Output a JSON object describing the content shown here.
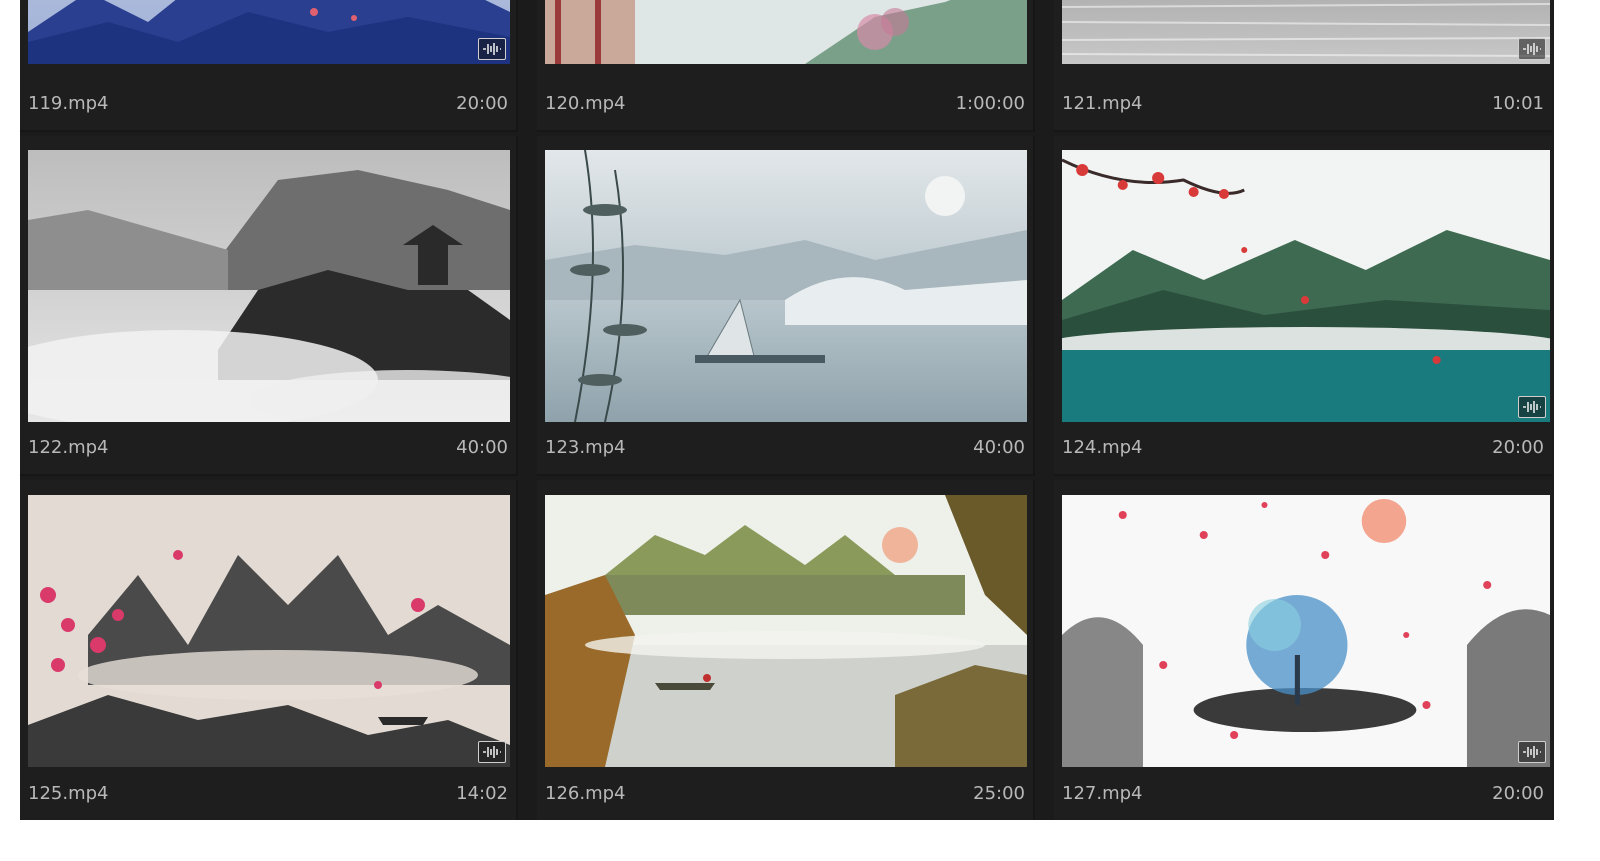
{
  "clips": [
    {
      "name": "119.mp4",
      "duration": "20:00",
      "has_audio": true,
      "scene": "blue-mountains"
    },
    {
      "name": "120.mp4",
      "duration": "1:00:00",
      "has_audio": false,
      "scene": "pavilion-blossom"
    },
    {
      "name": "121.mp4",
      "duration": "10:01",
      "has_audio": true,
      "scene": "grey-water"
    },
    {
      "name": "122.mp4",
      "duration": "40:00",
      "has_audio": false,
      "scene": "ink-mist-pagoda"
    },
    {
      "name": "123.mp4",
      "duration": "40:00",
      "has_audio": false,
      "scene": "bamboo-boat-lake"
    },
    {
      "name": "124.mp4",
      "duration": "20:00",
      "has_audio": true,
      "scene": "teal-mountains-blossom"
    },
    {
      "name": "125.mp4",
      "duration": "14:02",
      "has_audio": true,
      "scene": "ink-peaks-plum"
    },
    {
      "name": "126.mp4",
      "duration": "25:00",
      "has_audio": false,
      "scene": "autumn-lake"
    },
    {
      "name": "127.mp4",
      "duration": "20:00",
      "has_audio": true,
      "scene": "ink-tree-petals"
    }
  ],
  "icons": {
    "audio_badge": "audio-waveform-icon"
  },
  "colors": {
    "panel_bg": "#1b1b1b",
    "text": "#b8b8b8"
  }
}
